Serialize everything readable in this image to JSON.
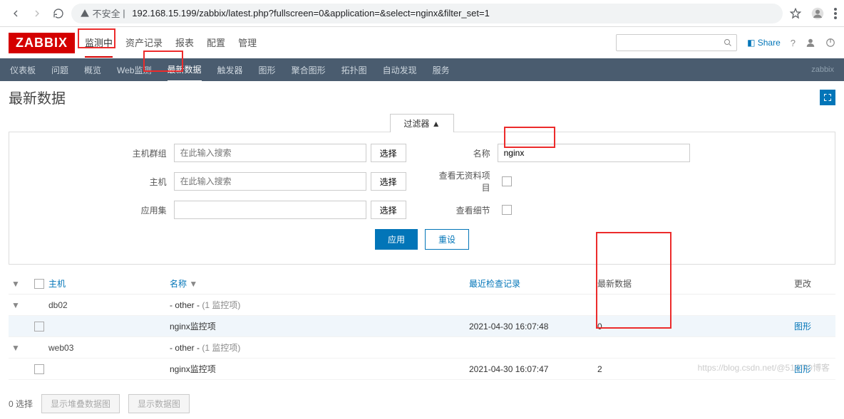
{
  "browser": {
    "insecure_label": "不安全",
    "url": "192.168.15.199/zabbix/latest.php?fullscreen=0&application=&select=nginx&filter_set=1"
  },
  "header": {
    "logo": "ZABBIX",
    "tabs": [
      "监测中",
      "资产记录",
      "报表",
      "配置",
      "管理"
    ],
    "share": "Share"
  },
  "subnav": {
    "items": [
      "仪表板",
      "问题",
      "概览",
      "Web监测",
      "最新数据",
      "触发器",
      "图形",
      "聚合图形",
      "拓扑图",
      "自动发现",
      "服务"
    ],
    "right": "zabbix"
  },
  "page": {
    "title": "最新数据"
  },
  "filter": {
    "tab": "过滤器 ▲",
    "labels": {
      "host_group": "主机群组",
      "host": "主机",
      "app": "应用集",
      "name": "名称",
      "no_data": "查看无资料项目",
      "detail": "查看细节"
    },
    "placeholder": "在此输入搜索",
    "select": "选择",
    "name_value": "nginx",
    "apply": "应用",
    "reset": "重设"
  },
  "table": {
    "headers": {
      "host": "主机",
      "name": "名称",
      "last_check": "最近检查记录",
      "latest": "最新数据",
      "change": "更改"
    },
    "groups": [
      {
        "host": "db02",
        "group_label": "- other -",
        "group_count": "(1 监控项)",
        "rows": [
          {
            "name": "nginx监控项",
            "last_check": "2021-04-30 16:07:48",
            "latest": "0",
            "link": "图形"
          }
        ]
      },
      {
        "host": "web03",
        "group_label": "- other -",
        "group_count": "(1 监控项)",
        "rows": [
          {
            "name": "nginx监控项",
            "last_check": "2021-04-30 16:07:47",
            "latest": "2",
            "link": "图形"
          }
        ]
      }
    ]
  },
  "footer": {
    "selected": "0 选择",
    "btn1": "显示堆叠数据图",
    "btn2": "显示数据图"
  },
  "watermark": "https://blog.csdn.net/@51CTO博客"
}
